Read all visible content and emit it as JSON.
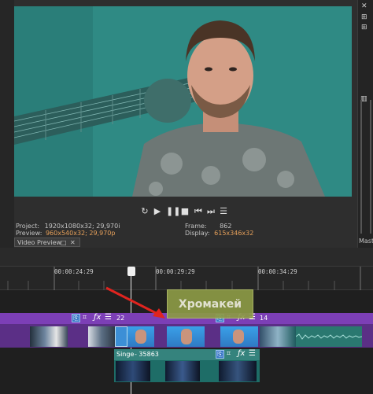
{
  "preview": {
    "project_label": "Project:",
    "project_value": "1920x1080x32; 29,970i",
    "preview_label": "Preview:",
    "preview_value_a": "960x540x32;",
    "preview_value_b": "29,970p",
    "frame_label": "Frame:",
    "frame_value": "862",
    "display_label": "Display:",
    "display_value": "615x346x32",
    "tab_title": "Video Preview"
  },
  "transport": {
    "loop_icon": "loop-icon",
    "play_icon": "play-icon",
    "pause_icon": "pause-icon",
    "stop_icon": "stop-icon",
    "prev_icon": "prev-frame-icon",
    "next_icon": "next-frame-icon",
    "menu_icon": "menu-icon"
  },
  "right_panel": {
    "label": "Mast"
  },
  "timeline": {
    "ruler_labels": [
      "00:00:24:29",
      "00:00:29:29",
      "00:00:34:29"
    ],
    "main_track": {
      "fade_left": "22",
      "fade_right": "14"
    },
    "singer_track": {
      "label": "Singe",
      "label_suffix": "- 35863"
    },
    "callout": "Хромакей"
  },
  "colors": {
    "accent": "#7c3fb6",
    "highlight_text": "#e6a05a",
    "teal_track": "#1e6d67",
    "arrow": "#e0241f"
  }
}
